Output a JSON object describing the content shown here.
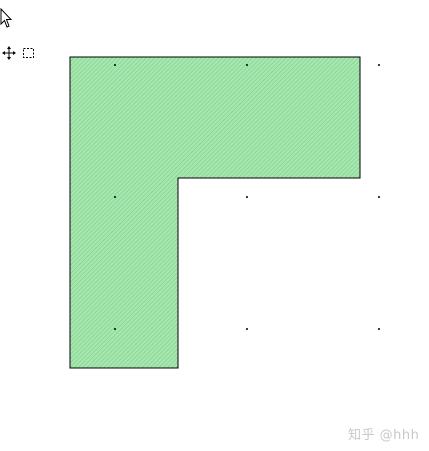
{
  "toolbar": {
    "tools": [
      {
        "icon": "cursor-icon"
      },
      {
        "icon": "move-icon"
      },
      {
        "icon": "select-rectangle-icon"
      }
    ]
  },
  "shape": {
    "type": "L-shaped polygon",
    "fill_color": "#a8e8b0",
    "hatch_color": "#78cc88",
    "stroke_color": "#000000"
  },
  "watermark": {
    "text": "知乎 @hhh"
  }
}
